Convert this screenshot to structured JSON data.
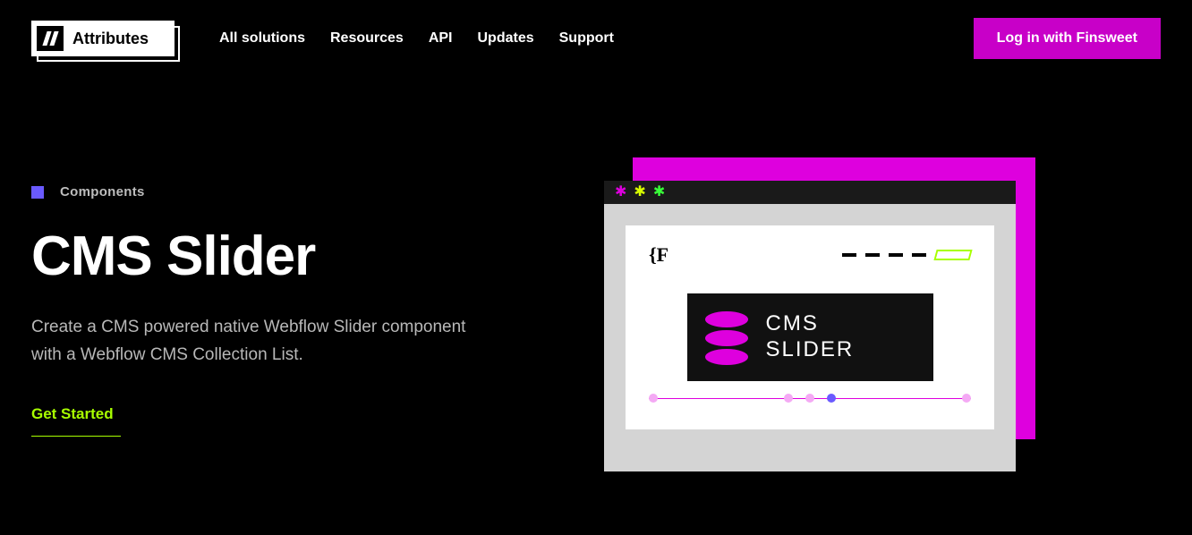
{
  "header": {
    "logo_text": "Attributes",
    "nav": [
      "All solutions",
      "Resources",
      "API",
      "Updates",
      "Support"
    ],
    "login_label": "Log in with Finsweet"
  },
  "hero": {
    "category": "Components",
    "title": "CMS Slider",
    "description": "Create a CMS powered native Webflow Slider component with a Webflow CMS Collection List.",
    "cta_label": "Get Started"
  },
  "illustration": {
    "brace_text": "{F",
    "tile_line1": "CMS",
    "tile_line2": "SLIDER"
  }
}
